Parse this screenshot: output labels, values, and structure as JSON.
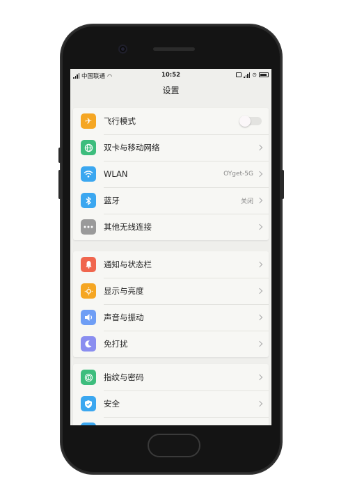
{
  "status_bar": {
    "carrier": "中国联通",
    "time": "10:52"
  },
  "page": {
    "title": "设置"
  },
  "groups": [
    {
      "items": [
        {
          "label": "飞行模式",
          "icon": "airplane-icon",
          "color": "#f5a623",
          "control": "toggle",
          "toggle_on": false
        },
        {
          "label": "双卡与移动网络",
          "icon": "globe-icon",
          "color": "#3dbd7d",
          "control": "chevron"
        },
        {
          "label": "WLAN",
          "icon": "wifi-icon",
          "color": "#3ba7f0",
          "value": "OYget-5G",
          "control": "chevron"
        },
        {
          "label": "蓝牙",
          "icon": "bluetooth-icon",
          "color": "#3ba7f0",
          "value": "关闭",
          "control": "chevron"
        },
        {
          "label": "其他无线连接",
          "icon": "more-icon",
          "color": "#9a9a9a",
          "control": "chevron"
        }
      ]
    },
    {
      "items": [
        {
          "label": "通知与状态栏",
          "icon": "bell-icon",
          "color": "#f0664e",
          "control": "chevron"
        },
        {
          "label": "显示与亮度",
          "icon": "brightness-icon",
          "color": "#f5a623",
          "control": "chevron"
        },
        {
          "label": "声音与振动",
          "icon": "speaker-icon",
          "color": "#6f9ef5",
          "control": "chevron"
        },
        {
          "label": "免打扰",
          "icon": "moon-icon",
          "color": "#8a8ef0",
          "control": "chevron"
        }
      ]
    },
    {
      "items": [
        {
          "label": "指纹与密码",
          "icon": "fingerprint-icon",
          "color": "#3dbd7d",
          "control": "chevron"
        },
        {
          "label": "安全",
          "icon": "shield-icon",
          "color": "#3ba7f0",
          "control": "chevron"
        }
      ]
    }
  ]
}
